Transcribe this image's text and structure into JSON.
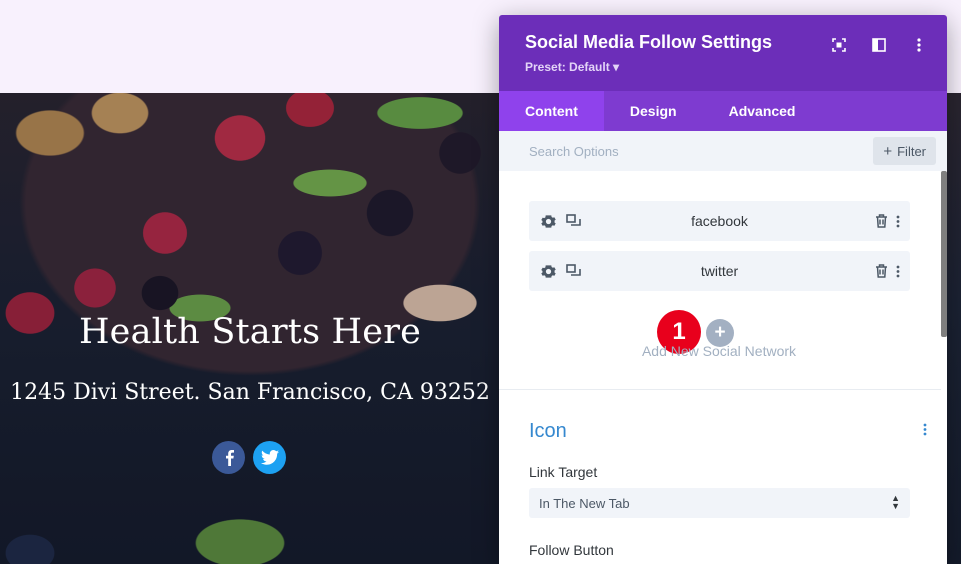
{
  "hero": {
    "title": "Health Starts Here",
    "address": "1245 Divi Street. San Francisco, CA 93252",
    "social": [
      {
        "name": "facebook",
        "glyph": "f",
        "color": "#3b5998"
      },
      {
        "name": "twitter",
        "glyph": "t",
        "color": "#1da1f2"
      }
    ]
  },
  "panel": {
    "title": "Social Media Follow Settings",
    "preset": "Preset: Default ▾",
    "header_icons": [
      "focus-icon",
      "split-view-icon",
      "more-vertical-icon"
    ],
    "tabs": [
      {
        "label": "Content",
        "active": true
      },
      {
        "label": "Design",
        "active": false
      },
      {
        "label": "Advanced",
        "active": false
      }
    ],
    "search": {
      "placeholder": "Search Options",
      "filter_label": "Filter"
    },
    "networks": [
      {
        "label": "facebook"
      },
      {
        "label": "twitter"
      }
    ],
    "badge_number": "1",
    "add_plus": "+",
    "add_label": "Add New Social Network",
    "section_title": "Icon",
    "link_target_label": "Link Target",
    "link_target_value": "In The New Tab",
    "follow_button_label": "Follow Button"
  },
  "colors": {
    "header": "#6c2eb9",
    "tabs": "#7e3bd0",
    "active_tab": "#8f42ec",
    "accent_blue": "#3588cf",
    "badge": "#e8001c"
  }
}
